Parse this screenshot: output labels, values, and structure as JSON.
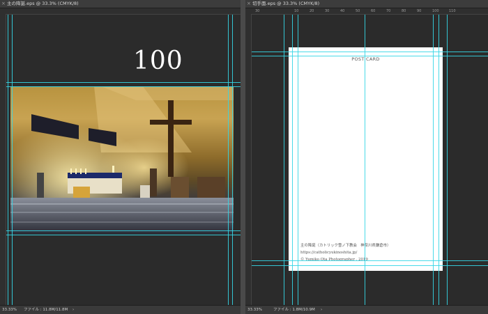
{
  "left_doc": {
    "tab_title": "主の降誕.eps @ 33.3% (CMYK/8)",
    "price_text": "100",
    "status": {
      "zoom": "33.33%",
      "file_info": "ファイル : 11.8M/11.8M",
      "arrow": "›"
    }
  },
  "right_doc": {
    "tab_title": "切手面.eps @ 33.3% (CMYK/8)",
    "ruler_labels": [
      "30",
      "10",
      "20",
      "30",
      "40",
      "50",
      "60",
      "70",
      "80",
      "90",
      "100",
      "110"
    ],
    "postcard": {
      "title": "POST CARD",
      "footer_line1": "主の降誕（カトリック雪ノ下教会　神奈川県鎌倉市）",
      "footer_line2": "https://catholicyukinoshita.jp/",
      "footer_line3": "© Yumiko Ota Photographer . 2019"
    },
    "status": {
      "zoom": "33.33%",
      "file_info": "ファイル : 1.8M/10.9M",
      "arrow": "›"
    }
  },
  "colors": {
    "guide": "#35d6e6",
    "canvas": "#282828",
    "panel": "#535353"
  },
  "icons": {
    "tab_close": "close-icon"
  }
}
